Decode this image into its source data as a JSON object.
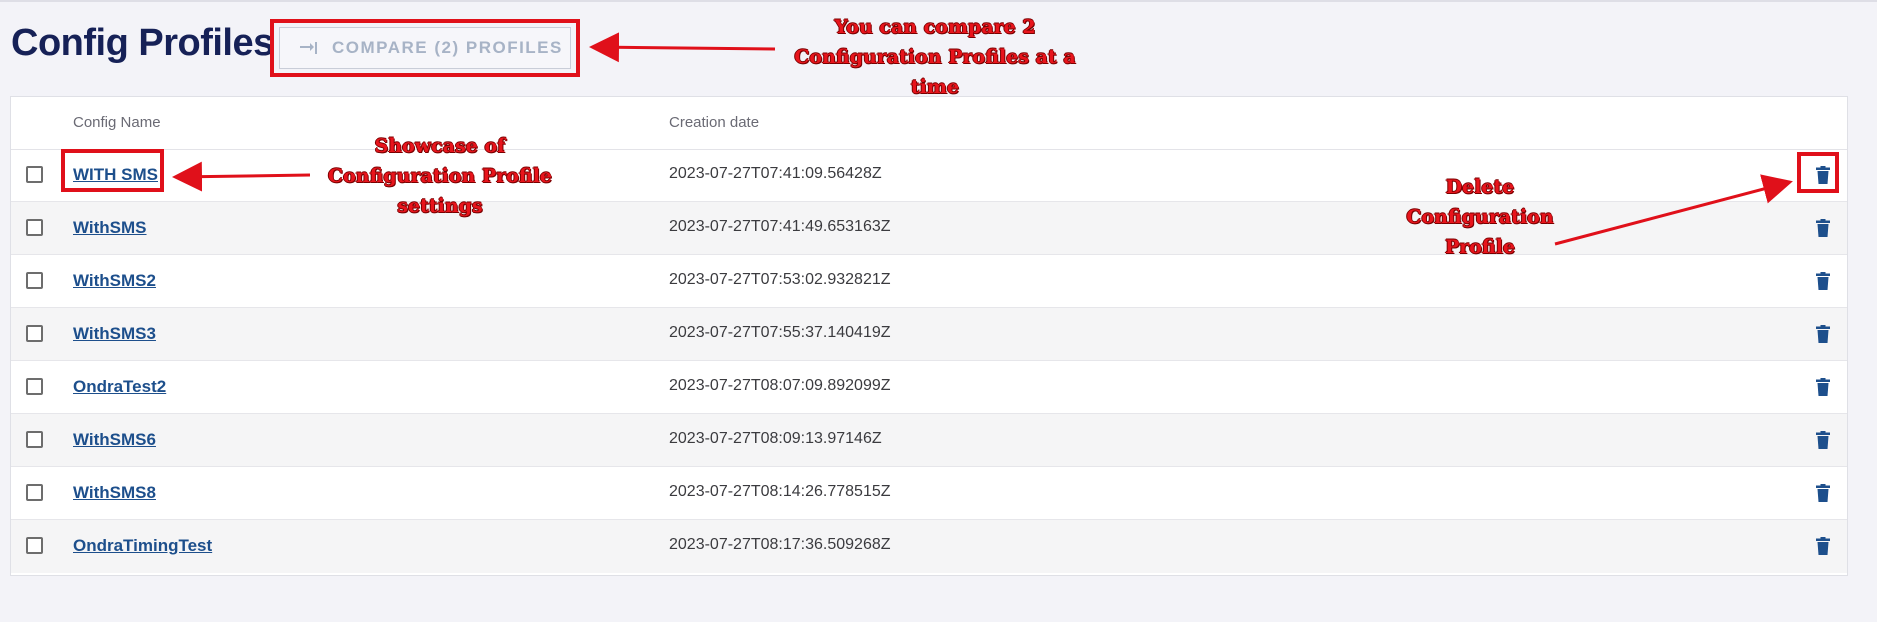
{
  "page": {
    "title": "Config Profiles"
  },
  "toolbar": {
    "compare_label": "COMPARE (2) PROFILES",
    "compare_icon": "compare-arrows-icon"
  },
  "table": {
    "columns": [
      "Config Name",
      "Creation date"
    ],
    "rows": [
      {
        "name": "WITH SMS",
        "created": "2023-07-27T07:41:09.56428Z"
      },
      {
        "name": "WithSMS",
        "created": "2023-07-27T07:41:49.653163Z"
      },
      {
        "name": "WithSMS2",
        "created": "2023-07-27T07:53:02.932821Z"
      },
      {
        "name": "WithSMS3",
        "created": "2023-07-27T07:55:37.140419Z"
      },
      {
        "name": "OndraTest2",
        "created": "2023-07-27T08:07:09.892099Z"
      },
      {
        "name": "WithSMS6",
        "created": "2023-07-27T08:09:13.97146Z"
      },
      {
        "name": "WithSMS8",
        "created": "2023-07-27T08:14:26.778515Z"
      },
      {
        "name": "OndraTimingTest",
        "created": "2023-07-27T08:17:36.509268Z"
      }
    ],
    "row_icon": "trash-icon"
  },
  "annotations": {
    "compare": [
      "You can compare 2",
      "Configuration Profiles at a",
      "time"
    ],
    "showcase": [
      "Showcase of",
      "Configuration Profile",
      "settings"
    ],
    "delete": [
      "Delete",
      "Configuration",
      "Profile"
    ]
  },
  "colors": {
    "title": "#162157",
    "link": "#1d4f8c",
    "annotation": "#e0101a",
    "icon": "#1d4f8c"
  }
}
